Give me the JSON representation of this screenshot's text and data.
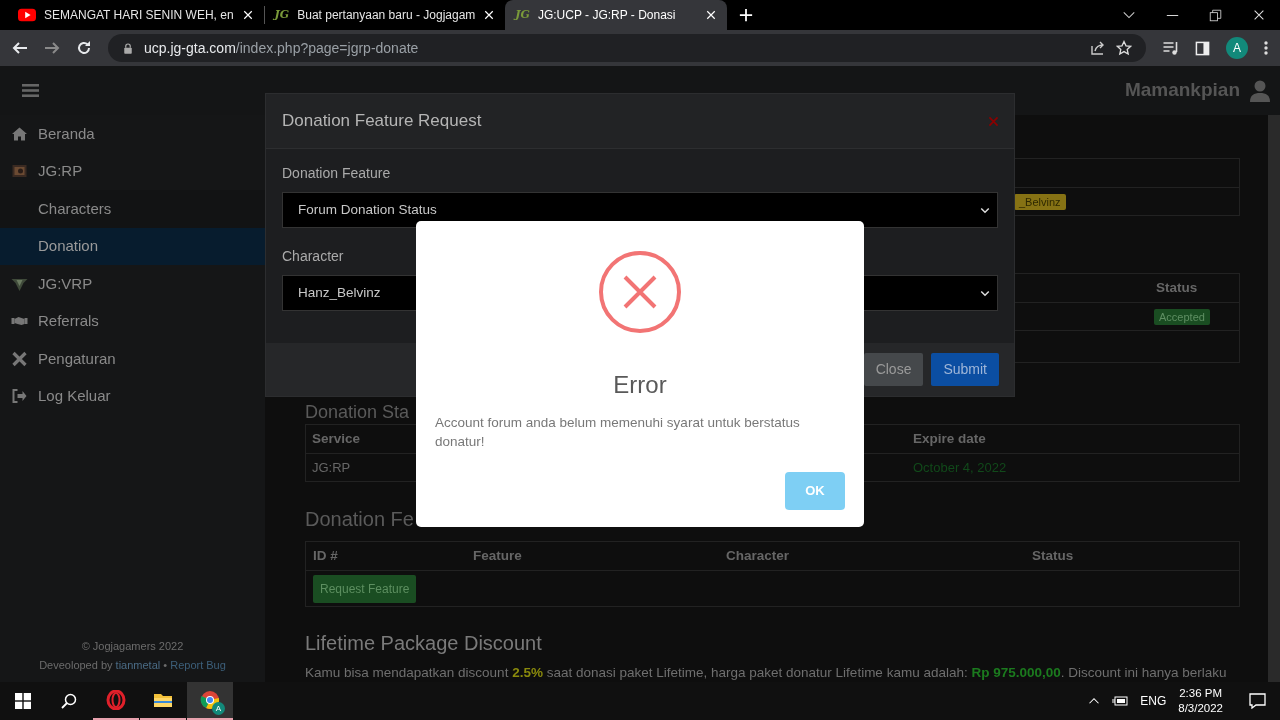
{
  "browser": {
    "tabs": [
      {
        "title": "SEMANGAT HARI SENIN WEH, en",
        "selected": false
      },
      {
        "title": "Buat pertanyaan baru - Jogjagam",
        "logo": "JG",
        "selected": false
      },
      {
        "title": "JG:UCP - JG:RP - Donasi",
        "logo": "JG",
        "selected": true
      }
    ],
    "address": {
      "host": "ucp.jg-gta.com",
      "path": "/index.php?page=jgrp-donate"
    },
    "profile": "A"
  },
  "topbar": {
    "user": "Mamankpian"
  },
  "sidebar": {
    "items": [
      {
        "label": "Beranda",
        "selected": false
      },
      {
        "label": "JG:RP",
        "selected": false,
        "children": [
          {
            "label": "Characters",
            "selected": false
          },
          {
            "label": "Donation",
            "selected": true
          }
        ]
      },
      {
        "label": "JG:VRP",
        "selected": false
      },
      {
        "label": "Referrals",
        "selected": false
      },
      {
        "label": "Pengaturan",
        "selected": false
      },
      {
        "label": "Log Keluar",
        "selected": false
      }
    ],
    "footer": {
      "copyright": "© Jogjagamers 2022",
      "credit": "Deveoloped by",
      "author": "tianmetal",
      "separator": "•",
      "report": "Report Bug"
    }
  },
  "content": {
    "giftcodes_table": {
      "badge": "_Belvinz"
    },
    "requests_table": {
      "column": "Status",
      "badge": "Accepted"
    },
    "donation_status": {
      "heading": "Donation Sta",
      "columns": [
        "Service",
        "Expire date"
      ],
      "rows": [
        [
          "JG:RP",
          "October 4, 2022"
        ]
      ]
    },
    "feature_requests": {
      "heading": "Donation Fe",
      "columns": [
        "ID #",
        "Feature",
        "Character",
        "Status"
      ],
      "button": "Request Feature"
    },
    "lifetime": {
      "heading": "Lifetime Package Discount",
      "segments": [
        {
          "kind": "plain",
          "text": "Kamu bisa mendapatkan discount "
        },
        {
          "kind": "percent",
          "text": "2.5%"
        },
        {
          "kind": "plain",
          "text": " saat donasi paket Lifetime, harga paket donatur Lifetime kamu adalah: "
        },
        {
          "kind": "price",
          "text": "Rp 975.000,00"
        },
        {
          "kind": "plain",
          "text": ". Discount ini hanya berlaku"
        }
      ]
    }
  },
  "modal": {
    "title": "Donation Feature Request",
    "fields": [
      {
        "label": "Donation Feature",
        "value": "Forum Donation Status"
      },
      {
        "label": "Character",
        "value": "Hanz_Belvinz"
      }
    ],
    "buttons": [
      {
        "label": "Close",
        "kind": "secondary"
      },
      {
        "label": "Submit",
        "kind": "primary"
      }
    ]
  },
  "alert": {
    "title": "Error",
    "message": "Account forum anda belum memenuhi syarat untuk berstatus donatur!",
    "button": "OK"
  },
  "taskbar": {
    "apps": [
      {
        "running": true,
        "selected": false
      },
      {
        "running": true,
        "selected": false
      },
      {
        "running": true,
        "selected": true,
        "badge": "A"
      }
    ],
    "language": "ENG",
    "time": "2:36 PM",
    "date": "8/3/2022"
  }
}
